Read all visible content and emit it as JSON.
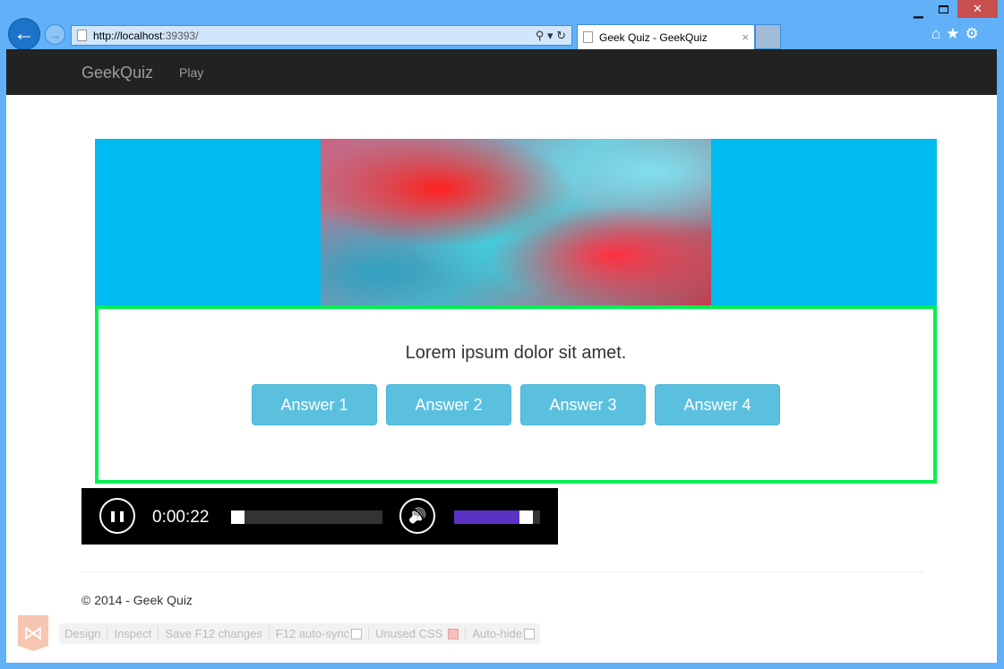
{
  "browser": {
    "url_host": "http://localhost",
    "url_port": ":39393/",
    "tab_title": "Geek Quiz - GeekQuiz",
    "tab_close": "×",
    "minimize": "▁",
    "close": "✕",
    "tools": "⌂★⚙",
    "back": "←",
    "forward": "→",
    "addr_tools": "⚲ ▾ ↻"
  },
  "nav": {
    "brand": "GeekQuiz",
    "play": "Play"
  },
  "quiz": {
    "question": "Lorem ipsum dolor sit amet.",
    "answers": [
      "Answer 1",
      "Answer 2",
      "Answer 3",
      "Answer 4"
    ]
  },
  "player": {
    "time": "0:00:22",
    "pause_icon": "❚❚",
    "volume_icon": "🔊",
    "progress_fraction": 0.0,
    "volume_fraction": 0.9
  },
  "footer": {
    "copyright": "© 2014 - Geek Quiz"
  },
  "browser_link": {
    "logo": "⋈",
    "items": [
      "Design",
      "Inspect",
      "Save F12 changes",
      "F12 auto-sync",
      "Unused CSS",
      "Auto-hide"
    ],
    "f12_auto_sync": false,
    "unused_css": true,
    "auto_hide": false
  },
  "colors": {
    "banner": "#00bbf0",
    "quiz_border": "#00f050",
    "answer": "#5bc0de",
    "volume": "#5b32c6"
  }
}
